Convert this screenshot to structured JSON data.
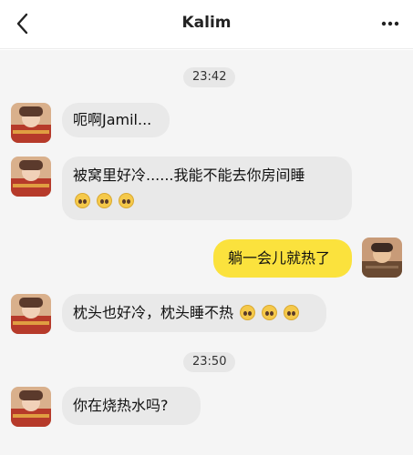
{
  "header": {
    "title": "Kalim"
  },
  "icons": {
    "back": "chevron-left-icon",
    "more": "more-horizontal-icon",
    "emoji": "pleading-face-emoji"
  },
  "colors": {
    "header_bg": "#ffffff",
    "chat_bg": "#f5f5f5",
    "incoming_bubble": "#e9e9e9",
    "outgoing_bubble": "#fbe23d",
    "time_pill": "#e7e7e7"
  },
  "messages": [
    {
      "type": "time",
      "text": "23:42"
    },
    {
      "type": "incoming",
      "text": "呃啊Jamil..."
    },
    {
      "type": "incoming",
      "text": "被窝里好冷......我能不能去你房间睡",
      "emoji_count": 3
    },
    {
      "type": "outgoing",
      "text": "躺一会儿就热了"
    },
    {
      "type": "incoming",
      "text": "枕头也好冷，枕头睡不热",
      "emoji_count": 3
    },
    {
      "type": "time",
      "text": "23:50"
    },
    {
      "type": "incoming",
      "text": "你在烧热水吗?"
    }
  ]
}
